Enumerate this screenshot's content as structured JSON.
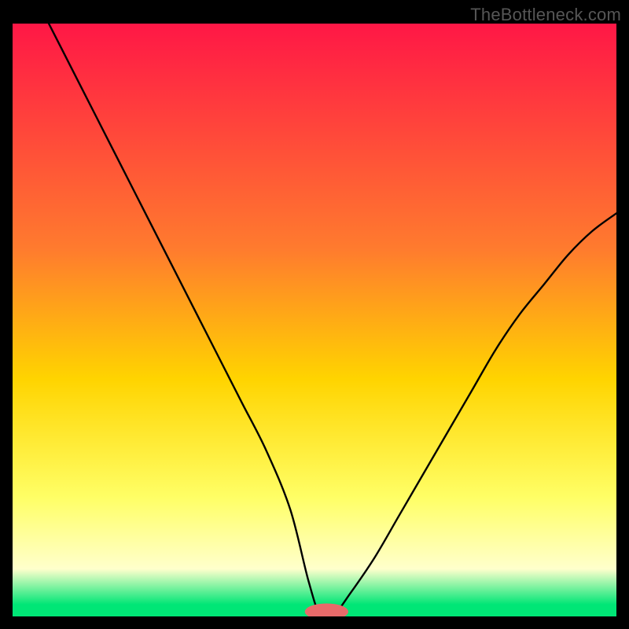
{
  "watermark": "TheBottleneck.com",
  "colors": {
    "frame": "#000000",
    "curve": "#000000",
    "marker_fill": "#e86a6a",
    "grad_top": "#ff1746",
    "grad_mid1": "#ff7b2e",
    "grad_mid2": "#ffd400",
    "grad_mid3": "#ffff66",
    "grad_pale": "#ffffcc",
    "grad_green": "#00e676"
  },
  "chart_data": {
    "type": "line",
    "title": "",
    "xlabel": "",
    "ylabel": "",
    "xlim": [
      0,
      100
    ],
    "ylim": [
      0,
      100
    ],
    "series": [
      {
        "name": "bottleneck-curve",
        "x": [
          6,
          10,
          14,
          18,
          22,
          26,
          30,
          34,
          38,
          42,
          46,
          49,
          51,
          53,
          56,
          60,
          64,
          68,
          72,
          76,
          80,
          84,
          88,
          92,
          96,
          100
        ],
        "y": [
          100,
          92,
          84,
          76,
          68,
          60,
          52,
          44,
          36,
          28,
          18,
          6,
          0,
          0,
          4,
          10,
          17,
          24,
          31,
          38,
          45,
          51,
          56,
          61,
          65,
          68
        ]
      }
    ],
    "marker": {
      "x": 52,
      "y": 0,
      "rx": 3.6,
      "ry": 1.4
    },
    "gradient_stops": [
      {
        "offset": 0,
        "color_key": "grad_top"
      },
      {
        "offset": 38,
        "color_key": "grad_mid1"
      },
      {
        "offset": 60,
        "color_key": "grad_mid2"
      },
      {
        "offset": 80,
        "color_key": "grad_mid3"
      },
      {
        "offset": 92,
        "color_key": "grad_pale"
      },
      {
        "offset": 98,
        "color_key": "grad_green"
      },
      {
        "offset": 100,
        "color_key": "grad_green"
      }
    ]
  }
}
